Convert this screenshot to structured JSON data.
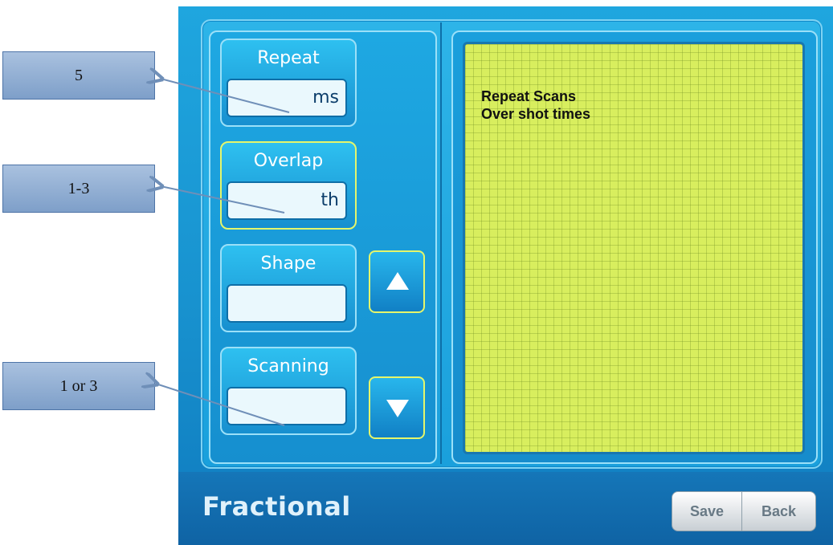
{
  "controls": [
    {
      "label": "Repeat",
      "value": "ms"
    },
    {
      "label": "Overlap",
      "value": "th"
    },
    {
      "label": "Shape",
      "value": ""
    },
    {
      "label": "Scanning",
      "value": ""
    }
  ],
  "display": {
    "line1": "Repeat Scans",
    "line2": "Over shot times"
  },
  "footer": {
    "title": "Fractional",
    "save_label": "Save",
    "back_label": "Back"
  },
  "callouts": [
    {
      "text": "5"
    },
    {
      "text": "1-3"
    },
    {
      "text": "1 or 3"
    }
  ],
  "colors": {
    "screen_blue": "#1892cf",
    "grid_green": "#d8ee5e",
    "active_border": "#e5f66b",
    "callout_fill": "#8fadd3"
  },
  "icons": [
    "up-arrow-icon",
    "down-arrow-icon"
  ]
}
